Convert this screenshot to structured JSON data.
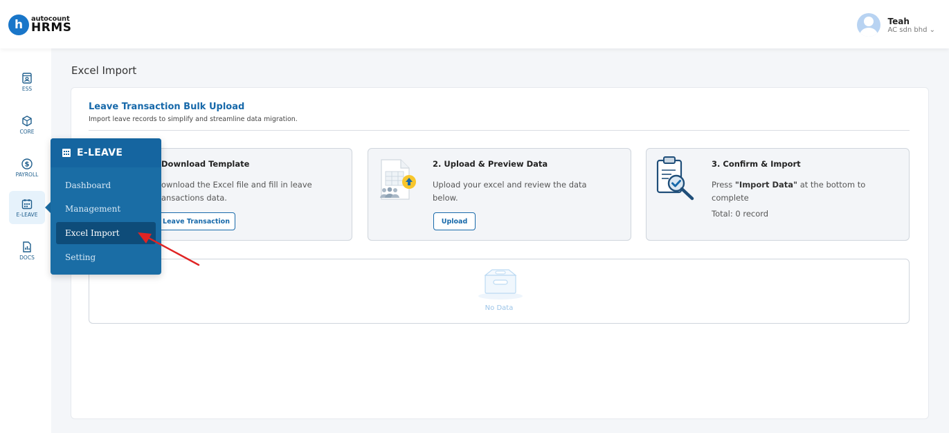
{
  "header": {
    "logo_letter": "h",
    "logo_small": "autocount",
    "logo_big": "HRMS",
    "user_name": "Teah",
    "company": "AC sdn bhd",
    "company_chevron": "⌄"
  },
  "rail": {
    "items": [
      {
        "label": "ESS",
        "icon": "id-badge-icon"
      },
      {
        "label": "CORE",
        "icon": "cube-icon"
      },
      {
        "label": "PAYROLL",
        "icon": "dollar-circle-icon"
      },
      {
        "label": "E-LEAVE",
        "icon": "calendar-icon"
      },
      {
        "label": "DOCS",
        "icon": "document-chart-icon"
      }
    ]
  },
  "flyout": {
    "title": "E-LEAVE",
    "items": [
      "Dashboard",
      "Management",
      "Excel Import",
      "Setting"
    ],
    "active_index": 2
  },
  "main": {
    "page_title": "Excel Import",
    "section_title": "Leave Transaction Bulk Upload",
    "section_subtitle": "Import leave records to simplify and streamline data migration.",
    "steps": [
      {
        "title": "Download Template",
        "desc1": "ownload the Excel file and fill in leave",
        "desc2": "ansactions data.",
        "button": "Leave Transaction"
      },
      {
        "title": "2. Upload & Preview Data",
        "desc1": "Upload your excel and review the data",
        "desc2": "below.",
        "button": "Upload"
      },
      {
        "title": "3. Confirm & Import",
        "desc_prefix": "Press ",
        "desc_bold": "\"Import Data\"",
        "desc_suffix": " at the bottom to",
        "desc2": "complete",
        "total": "Total: 0 record"
      }
    ],
    "no_data": "No Data"
  },
  "colors": {
    "brand": "#1769aa",
    "flyout": "#1a6da5",
    "annotation_arrow": "#e02424"
  }
}
